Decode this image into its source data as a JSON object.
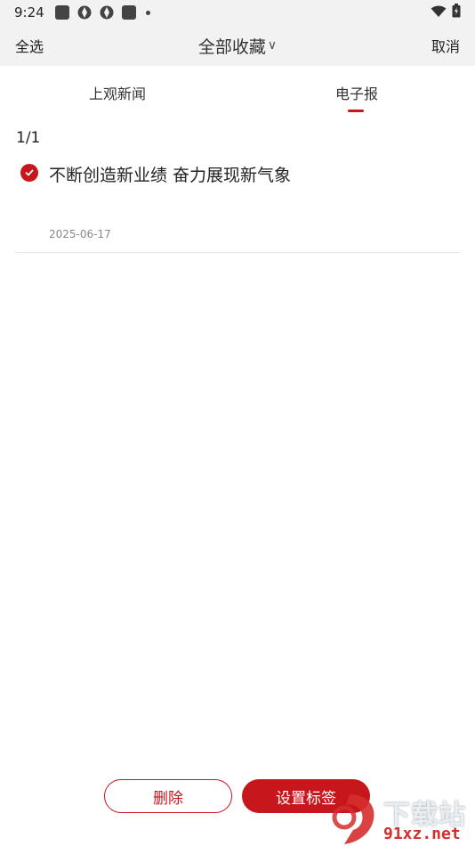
{
  "status_bar": {
    "time": "9:24",
    "notification_icons": [
      "app-square-icon",
      "aperture-icon",
      "aperture-icon",
      "app-square-icon",
      "dot-icon"
    ],
    "right_icons": [
      "wifi-icon",
      "battery-icon"
    ]
  },
  "top_bar": {
    "select_all_label": "全选",
    "title": "全部收藏",
    "title_dropdown_glyph": "∨",
    "cancel_label": "取消"
  },
  "tabs": [
    {
      "label": "上观新闻",
      "active": false
    },
    {
      "label": "电子报",
      "active": true
    }
  ],
  "list": {
    "counter": "1/1",
    "items": [
      {
        "title": "不断创造新业绩 奋力展现新气象",
        "date": "2025-06-17",
        "selected": true
      }
    ]
  },
  "actions": {
    "delete_label": "删除",
    "set_tag_label": "设置标签"
  },
  "watermark": {
    "top_text": "下载站",
    "bottom_text": "91xz.net"
  },
  "colors": {
    "accent": "#c8161d",
    "background": "#ffffff",
    "bar_background": "#f2f2f2"
  }
}
